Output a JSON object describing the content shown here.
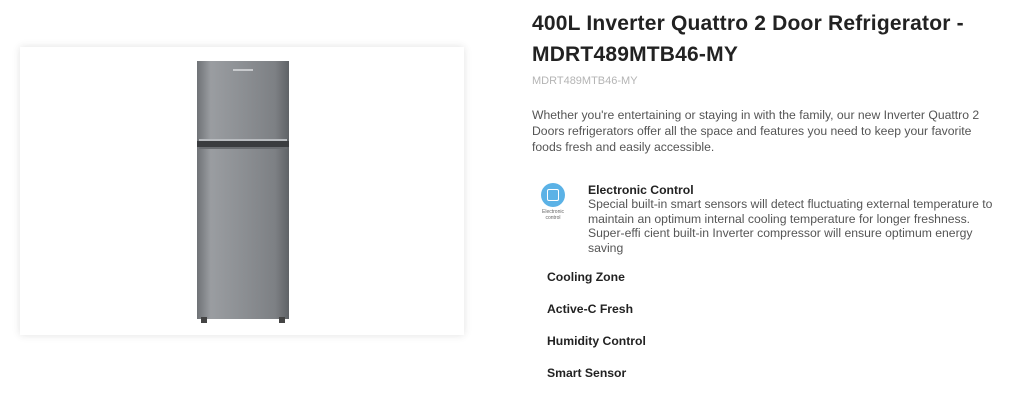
{
  "product": {
    "title": "400L Inverter Quattro 2 Door Refrigerator - MDRT489MTB46-MY",
    "sku": "MDRT489MTB46-MY",
    "description": "Whether you're entertaining or staying in with the family, our new Inverter Quattro 2 Doors refrigerators offer all the space and features you need to keep your favorite foods fresh and easily accessible."
  },
  "feature": {
    "icon": "electronic-control-icon",
    "icon_caption": "Electronic control",
    "title": "Electronic Control",
    "body": "Special built-in smart sensors will detect fluctuating external temperature to maintain an optimum internal cooling temperature for longer freshness. Super-effi cient built-in Inverter compressor will ensure optimum energy saving"
  },
  "sections": [
    {
      "label": "Cooling Zone"
    },
    {
      "label": "Active-C Fresh"
    },
    {
      "label": "Humidity Control"
    },
    {
      "label": "Smart Sensor"
    }
  ],
  "colors": {
    "icon_blue": "#5bb2e6",
    "fridge_steel": "#8a8d91"
  }
}
